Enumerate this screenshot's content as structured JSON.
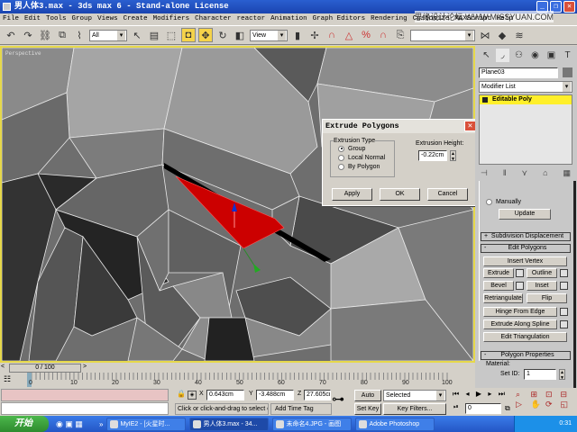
{
  "window": {
    "title": "男人体3.max - 3ds max 6 - Stand-alone License",
    "watermark": "思缘设计论坛 WWW.MISSYUAN.COM"
  },
  "menu": [
    "File",
    "Edit",
    "Tools",
    "Group",
    "Views",
    "Create",
    "Modifiers",
    "Character",
    "reactor",
    "Animation",
    "Graph Editors",
    "Rendering",
    "Customize",
    "MAXScript",
    "Help"
  ],
  "toolbar": {
    "selection_filter": "All",
    "ref_coord": "View",
    "named_sel": ""
  },
  "viewport": {
    "label": "Perspective",
    "accent": "#e6d84a",
    "selection_color": "#cc0000"
  },
  "dialog": {
    "title": "Extrude Polygons",
    "group_label": "Extrusion Type",
    "options": [
      "Group",
      "Local Normal",
      "By Polygon"
    ],
    "selected": "Group",
    "height_label": "Extrusion Height:",
    "height_value": "-0.22cm",
    "apply": "Apply",
    "ok": "OK",
    "cancel": "Cancel"
  },
  "command_panel": {
    "object_name": "Plane03",
    "modifier_list": "Modifier List",
    "stack_item": "Editable Poly",
    "manually": "Manually",
    "update": "Update",
    "rollouts": {
      "subdiv": "Subdivision Displacement",
      "edit_polygons": "Edit Polygons",
      "poly_props": "Polygon Properties"
    },
    "buttons": {
      "insert_vertex": "Insert Vertex",
      "extrude": "Extrude",
      "outline": "Outline",
      "bevel": "Bevel",
      "inset": "Inset",
      "retriangulate": "Retriangulate",
      "flip": "Flip",
      "hinge": "Hinge From Edge",
      "extrude_spline": "Extrude Along Spline",
      "edit_tri": "Edit Triangulation"
    },
    "material_label": "Material:",
    "set_id_label": "Set ID:",
    "set_id_value": "1"
  },
  "timeline": {
    "frame": "0 / 100",
    "progress": 0,
    "ticks": [
      "0",
      "10",
      "20",
      "30",
      "40",
      "50",
      "60",
      "70",
      "80",
      "90",
      "100"
    ]
  },
  "status": {
    "x": "0.643cm",
    "y": "-3.488cm",
    "z": "27.605cm",
    "prompt": "Click or click-and-drag to select obj",
    "add_time_tag": "Add Time Tag",
    "auto_key": "Auto Key",
    "set_key": "Set Key",
    "key_mode": "Selected",
    "key_filters": "Key Filters...",
    "current_frame": "0"
  },
  "taskbar": {
    "start": "开始",
    "tasks": [
      "MyIE2 - [火星时...",
      "男人体3.max - 34...",
      "未命名4.JPG - 画图",
      "Adobe Photoshop"
    ],
    "clock": "0:31"
  }
}
